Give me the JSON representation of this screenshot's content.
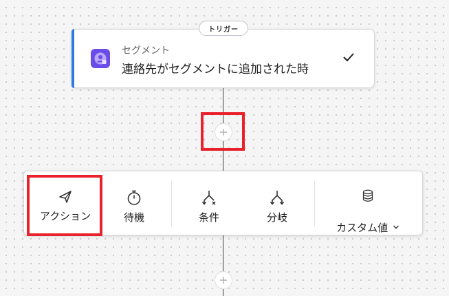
{
  "trigger": {
    "badge": "トリガー",
    "subtitle": "セグメント",
    "title": "連絡先がセグメントに追加された時",
    "accent_color": "#2f7be5",
    "icon": "segment-user-icon",
    "icon_color": "#6a4de8",
    "status_icon": "checkmark-icon"
  },
  "add_step": {
    "icon": "plus-icon"
  },
  "toolbar": {
    "items": [
      {
        "label": "アクション",
        "icon": "send-arrow-icon",
        "highlighted": true
      },
      {
        "label": "待機",
        "icon": "stopwatch-icon"
      },
      {
        "label": "条件",
        "icon": "condition-branch-icon"
      },
      {
        "label": "分岐",
        "icon": "split-branch-icon"
      },
      {
        "label": "カスタム値",
        "icon": "database-icon",
        "dropdown_icon": "chevron-down-icon"
      }
    ]
  },
  "highlight_color": "#e8212a"
}
